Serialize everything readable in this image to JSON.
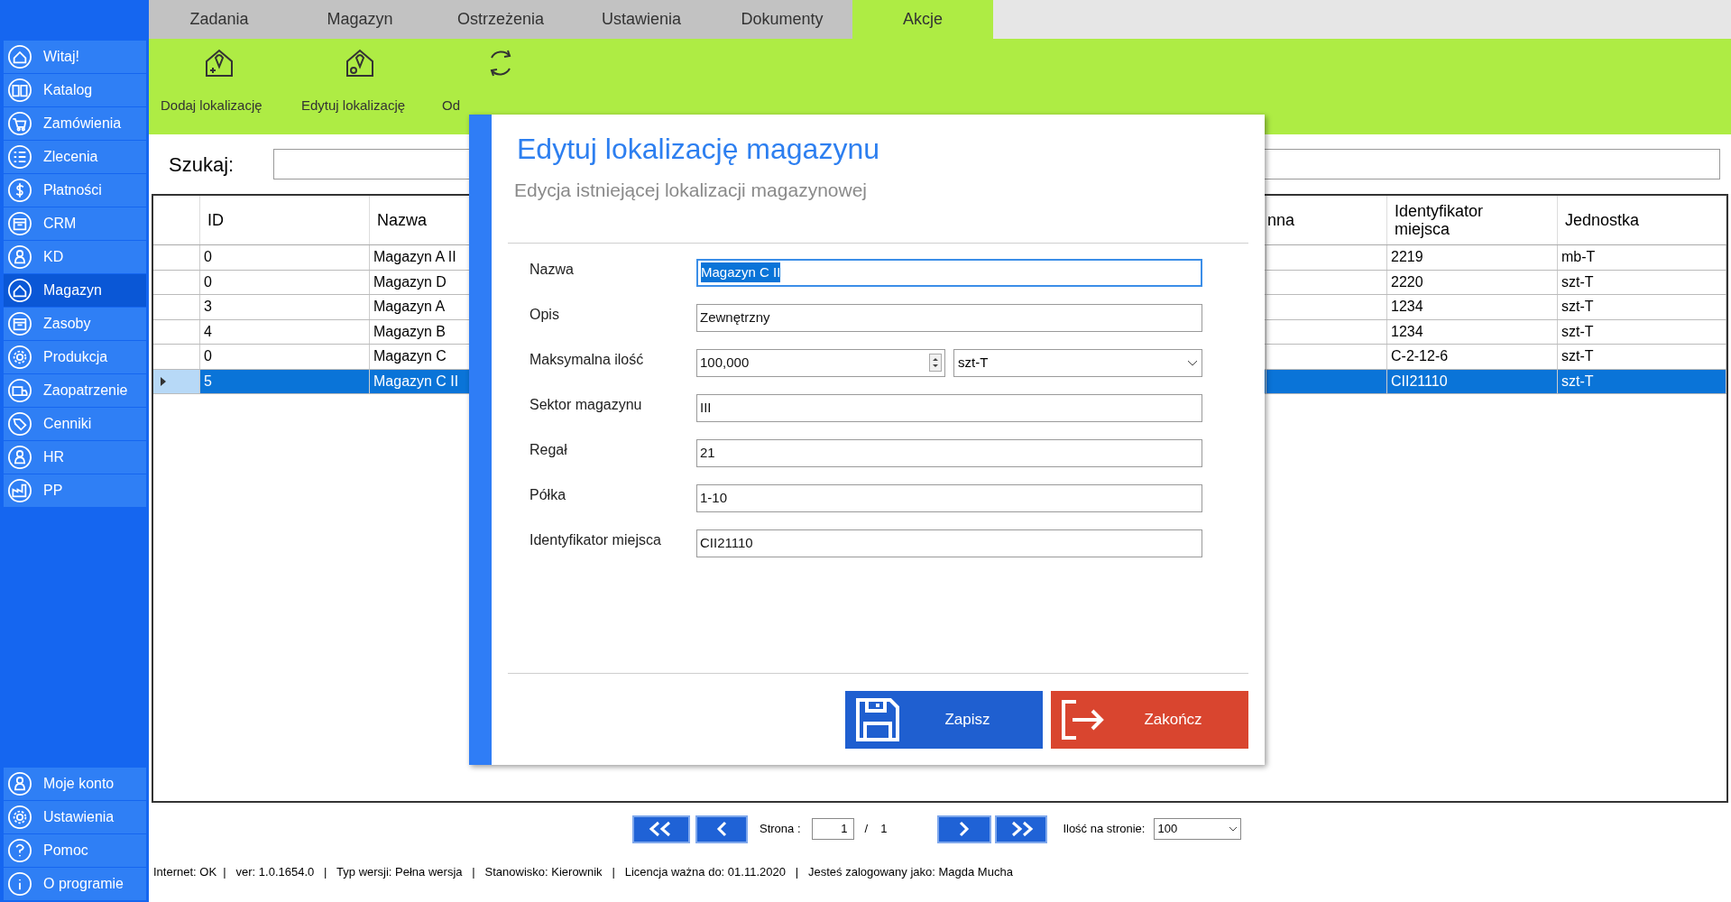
{
  "sidebar": {
    "items": [
      {
        "label": "Witaj!",
        "selected": false
      },
      {
        "label": "Katalog",
        "selected": false
      },
      {
        "label": "Zamówienia",
        "selected": false
      },
      {
        "label": "Zlecenia",
        "selected": false
      },
      {
        "label": "Płatności",
        "selected": false
      },
      {
        "label": "CRM",
        "selected": false
      },
      {
        "label": "KD",
        "selected": false
      },
      {
        "label": "Magazyn",
        "selected": true
      },
      {
        "label": "Zasoby",
        "selected": false
      },
      {
        "label": "Produkcja",
        "selected": false
      },
      {
        "label": "Zaopatrzenie",
        "selected": false
      },
      {
        "label": "Cenniki",
        "selected": false
      },
      {
        "label": "HR",
        "selected": false
      },
      {
        "label": "PP",
        "selected": false
      }
    ],
    "bottom_items": [
      {
        "label": "Moje konto",
        "selected": false
      },
      {
        "label": "Ustawienia",
        "selected": false
      },
      {
        "label": "Pomoc",
        "selected": false
      },
      {
        "label": "O programie",
        "selected": false
      }
    ]
  },
  "tabs": [
    {
      "label": "Zadania",
      "selected": false
    },
    {
      "label": "Magazyn",
      "selected": false
    },
    {
      "label": "Ostrzeżenia",
      "selected": false
    },
    {
      "label": "Ustawienia",
      "selected": false
    },
    {
      "label": "Dokumenty",
      "selected": false
    },
    {
      "label": "Akcje",
      "selected": true
    }
  ],
  "toolbar": {
    "buttons": [
      {
        "label": "Dodaj lokalizację",
        "kind": "add"
      },
      {
        "label": "Edytuj lokalizację",
        "kind": "edit"
      },
      {
        "label": "Od",
        "kind": "refresh"
      }
    ]
  },
  "search": {
    "label": "Szukaj:"
  },
  "table": {
    "columns": [
      "ID",
      "Nazwa",
      "nna",
      "Identyfikator miejsca",
      "Jednostka"
    ],
    "rows": [
      {
        "id": "0",
        "name": "Magazyn A II",
        "place_id": "2219",
        "unit": "mb-T",
        "selected": false
      },
      {
        "id": "0",
        "name": "Magazyn D",
        "place_id": "2220",
        "unit": "szt-T",
        "selected": false
      },
      {
        "id": "3",
        "name": "Magazyn A",
        "place_id": "1234",
        "unit": "szt-T",
        "selected": false
      },
      {
        "id": "4",
        "name": "Magazyn B",
        "place_id": "1234",
        "unit": "szt-T",
        "selected": false
      },
      {
        "id": "0",
        "name": "Magazyn C",
        "place_id": "C-2-12-6",
        "unit": "szt-T",
        "selected": false
      },
      {
        "id": "5",
        "name": "Magazyn C II",
        "place_id": "CII21110",
        "unit": "szt-T",
        "selected": true
      }
    ]
  },
  "dialog": {
    "title": "Edytuj lokalizację magazynu",
    "subtitle": "Edycja istniejącej lokalizacji magazynowej",
    "fields": [
      {
        "label": "Nazwa",
        "kind": "text",
        "value": "Magazyn C II",
        "focused": true
      },
      {
        "label": "Opis",
        "kind": "text",
        "value": "Zewnętrzny",
        "focused": false
      },
      {
        "label": "Maksymalna ilość",
        "kind": "quantity",
        "value": "100,000",
        "unit": "szt-T",
        "focused": false
      },
      {
        "label": "Sektor magazynu",
        "kind": "text",
        "value": "III",
        "focused": false
      },
      {
        "label": "Regał",
        "kind": "text",
        "value": "21",
        "focused": false
      },
      {
        "label": "Półka",
        "kind": "text",
        "value": "1-10",
        "focused": false
      },
      {
        "label": "Identyfikator miejsca",
        "kind": "text",
        "value": "CII21110",
        "focused": false
      }
    ],
    "buttons": [
      {
        "label": "Zapisz",
        "kind": "save"
      },
      {
        "label": "Zakończ",
        "kind": "exit"
      }
    ]
  },
  "pagination": {
    "page_label": "Strona :",
    "page": "1",
    "separator": "/",
    "total": "1",
    "per_page_label": "Ilość na stronie:",
    "per_page": "100"
  },
  "status_bar": "Internet: OK  |   ver: 1.0.1654.0   |   Typ wersji: Pełna wersja   |   Stanowisko: Kierownik   |   Licencja ważna do: 01.11.2020   |   Jesteś zalogowany jako: Magda Mucha"
}
